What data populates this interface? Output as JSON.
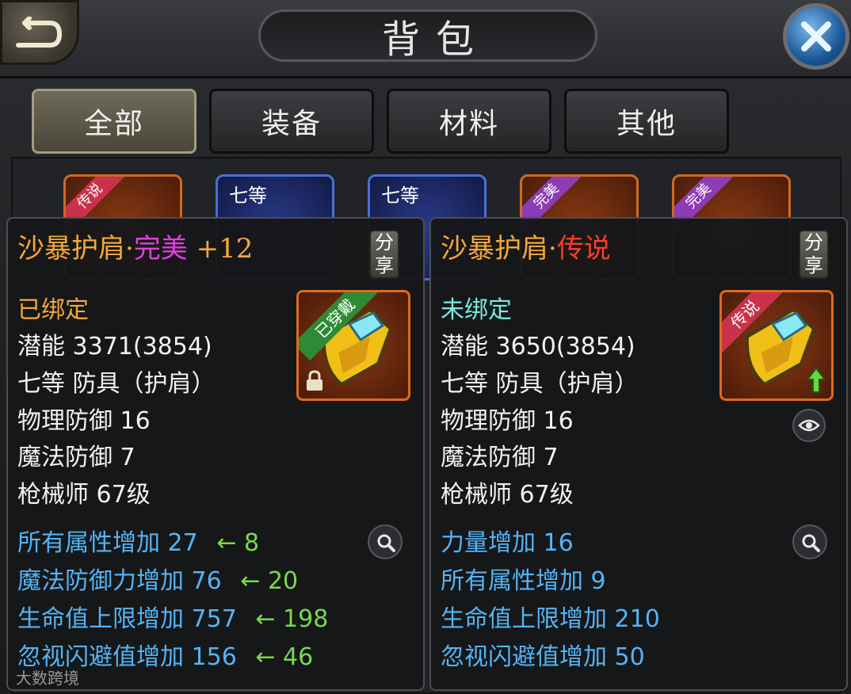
{
  "window": {
    "title": "背包"
  },
  "tabs": [
    {
      "label": "全部",
      "active": true
    },
    {
      "label": "装备",
      "active": false
    },
    {
      "label": "材料",
      "active": false
    },
    {
      "label": "其他",
      "active": false
    }
  ],
  "grid_badges": {
    "legend": "传说",
    "grade7": "七等",
    "perfect": "完美"
  },
  "left_item": {
    "name": "沙暴护肩",
    "separator": "·",
    "quality": "完美",
    "enhance": "+12",
    "share_label": "分享",
    "worn_badge": "已穿戴",
    "bind_status": "已绑定",
    "potential": "潜能 3371(3854)",
    "type": "七等 防具（护肩）",
    "physical_defense": "物理防御 16",
    "magic_defense": "魔法防御 7",
    "requirement": "枪械师 67级",
    "bonuses": [
      {
        "text": "所有属性增加 27",
        "compare": "← 8"
      },
      {
        "text": "魔法防御力增加 76",
        "compare": "← 20"
      },
      {
        "text": "生命值上限增加 757",
        "compare": "← 198"
      },
      {
        "text": "忽视闪避值增加 156",
        "compare": "← 46"
      }
    ]
  },
  "right_item": {
    "name": "沙暴护肩",
    "separator": "·",
    "quality": "传说",
    "share_label": "分享",
    "legend_badge": "传说",
    "bind_status": "未绑定",
    "potential": "潜能 3650(3854)",
    "type": "七等 防具（护肩）",
    "physical_defense": "物理防御 16",
    "magic_defense": "魔法防御 7",
    "requirement": "枪械师 67级",
    "bonuses": [
      {
        "text": "力量增加 16"
      },
      {
        "text": "所有属性增加 9"
      },
      {
        "text": "生命值上限增加 210"
      },
      {
        "text": "忽视闪避值增加 50"
      }
    ]
  },
  "watermark": "大数跨境",
  "colors": {
    "quality_perfect": "#e040e0",
    "quality_legend": "#ff3c28",
    "bound": "#f4a83a",
    "unbound": "#7ae8e0",
    "bonus": "#54b4f4",
    "compare": "#7ad850"
  },
  "icons": [
    "back-arrow-icon",
    "close-x-icon",
    "lock-icon",
    "upgrade-arrow-icon",
    "eye-icon",
    "magnifier-icon"
  ]
}
